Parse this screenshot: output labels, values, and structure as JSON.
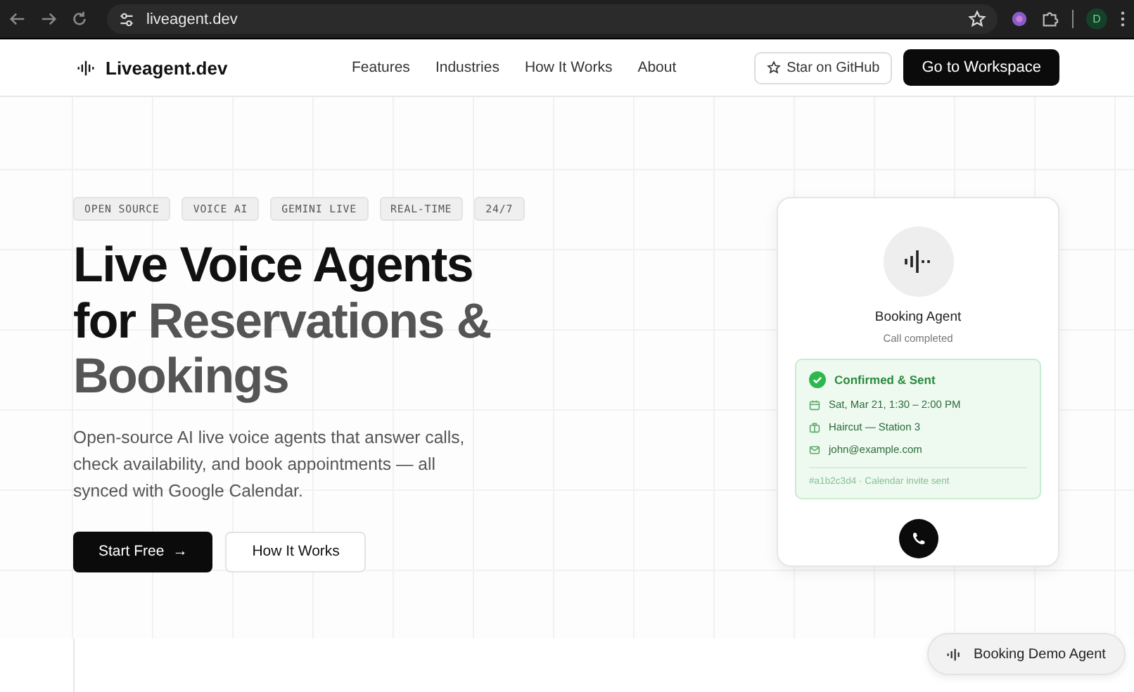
{
  "browser": {
    "url": "liveagent.dev",
    "profile": "D"
  },
  "nav": {
    "brand": "Liveagent.dev",
    "links": [
      "Features",
      "Industries",
      "How It Works",
      "About"
    ],
    "github": "Star on GitHub",
    "cta": "Go to Workspace"
  },
  "hero": {
    "tags": [
      "OPEN SOURCE",
      "VOICE AI",
      "GEMINI LIVE",
      "REAL-TIME",
      "24/7"
    ],
    "title": [
      {
        "text": "Live Voice Agents for",
        "muted": false
      },
      {
        "text": "Reservations & Bookings",
        "muted": true
      }
    ],
    "description": "Open-source AI live voice agents that answer calls, check availability, and book appointments — all synced with Google Calendar.",
    "buttons": [
      {
        "label": "Start Free",
        "kind": "primary",
        "arrow": "→"
      },
      {
        "label": "How It Works",
        "kind": "secondary"
      }
    ]
  },
  "card": {
    "name": "Booking Agent",
    "status": "Call completed",
    "confirmation": {
      "title": "Confirmed & Sent",
      "details": [
        {
          "kind": "calendar",
          "text": "Sat, Mar 21, 1:30 – 2:00 PM"
        },
        {
          "kind": "place",
          "text": "Haircut — Station 3"
        },
        {
          "kind": "mail",
          "text": "john@example.com"
        }
      ],
      "footer": "#a1b2c3d4 · Calendar invite sent"
    }
  },
  "floating": {
    "label": "Booking Demo Agent"
  }
}
